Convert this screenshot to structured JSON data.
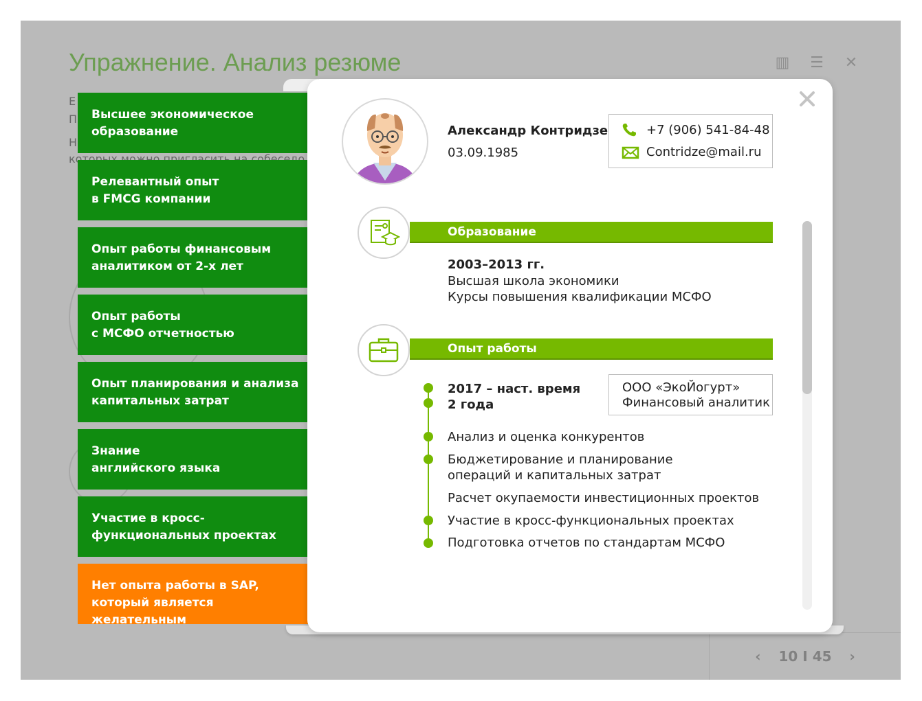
{
  "background": {
    "title": "Упражнение. Анализ резюме",
    "text_line_1": "Е",
    "text_line_2": "П",
    "text_line_3": "Н",
    "text_line_4": "которых можно пригласить на собеседо",
    "pager": {
      "current": "10",
      "separator": "I",
      "total": "45"
    }
  },
  "cards": [
    {
      "text": "Высшее экономическое\nобразование",
      "status": "positive"
    },
    {
      "text": "Релевантный опыт\nв FMCG компании",
      "status": "positive"
    },
    {
      "text": "Опыт работы финансовым\nаналитиком от 2-х лет",
      "status": "positive"
    },
    {
      "text": "Опыт работы\nс МСФО отчетностью",
      "status": "positive"
    },
    {
      "text": "Опыт планирования и анализа\nкапитальных затрат",
      "status": "positive"
    },
    {
      "text": "Знание\nанглийского языка",
      "status": "positive"
    },
    {
      "text": "Участие в кросс-\nфункциональных проектах",
      "status": "positive"
    },
    {
      "text": "Нет опыта работы в SAP,\nкоторый является желательным",
      "status": "negative"
    }
  ],
  "resume": {
    "name": "Александр Контридзе",
    "dob": "03.09.1985",
    "phone": "+7 (906) 541-84-48",
    "email": "Contridze@mail.ru",
    "education": {
      "heading": "Образование",
      "years": "2003–2013 гг.",
      "lines": [
        "Высшая школа экономики",
        "Курсы повышения квалификации МСФО"
      ]
    },
    "experience": {
      "heading": "Опыт работы",
      "period": "2017 – наст. время\n2 года",
      "company": "ООО «ЭкоЙогурт»\nФинансовый аналитик",
      "duties": [
        "Анализ и оценка конкурентов",
        "Бюджетирование и планирование\nопераций и капитальных затрат",
        "Расчет окупаемости инвестиционных проектов",
        "Участие в кросс-функциональных проектах",
        "Подготовка отчетов по стандартам МСФО"
      ]
    }
  },
  "colors": {
    "card_green": "#108c10",
    "card_orange": "#ff7f00",
    "accent_green": "#76b900"
  }
}
